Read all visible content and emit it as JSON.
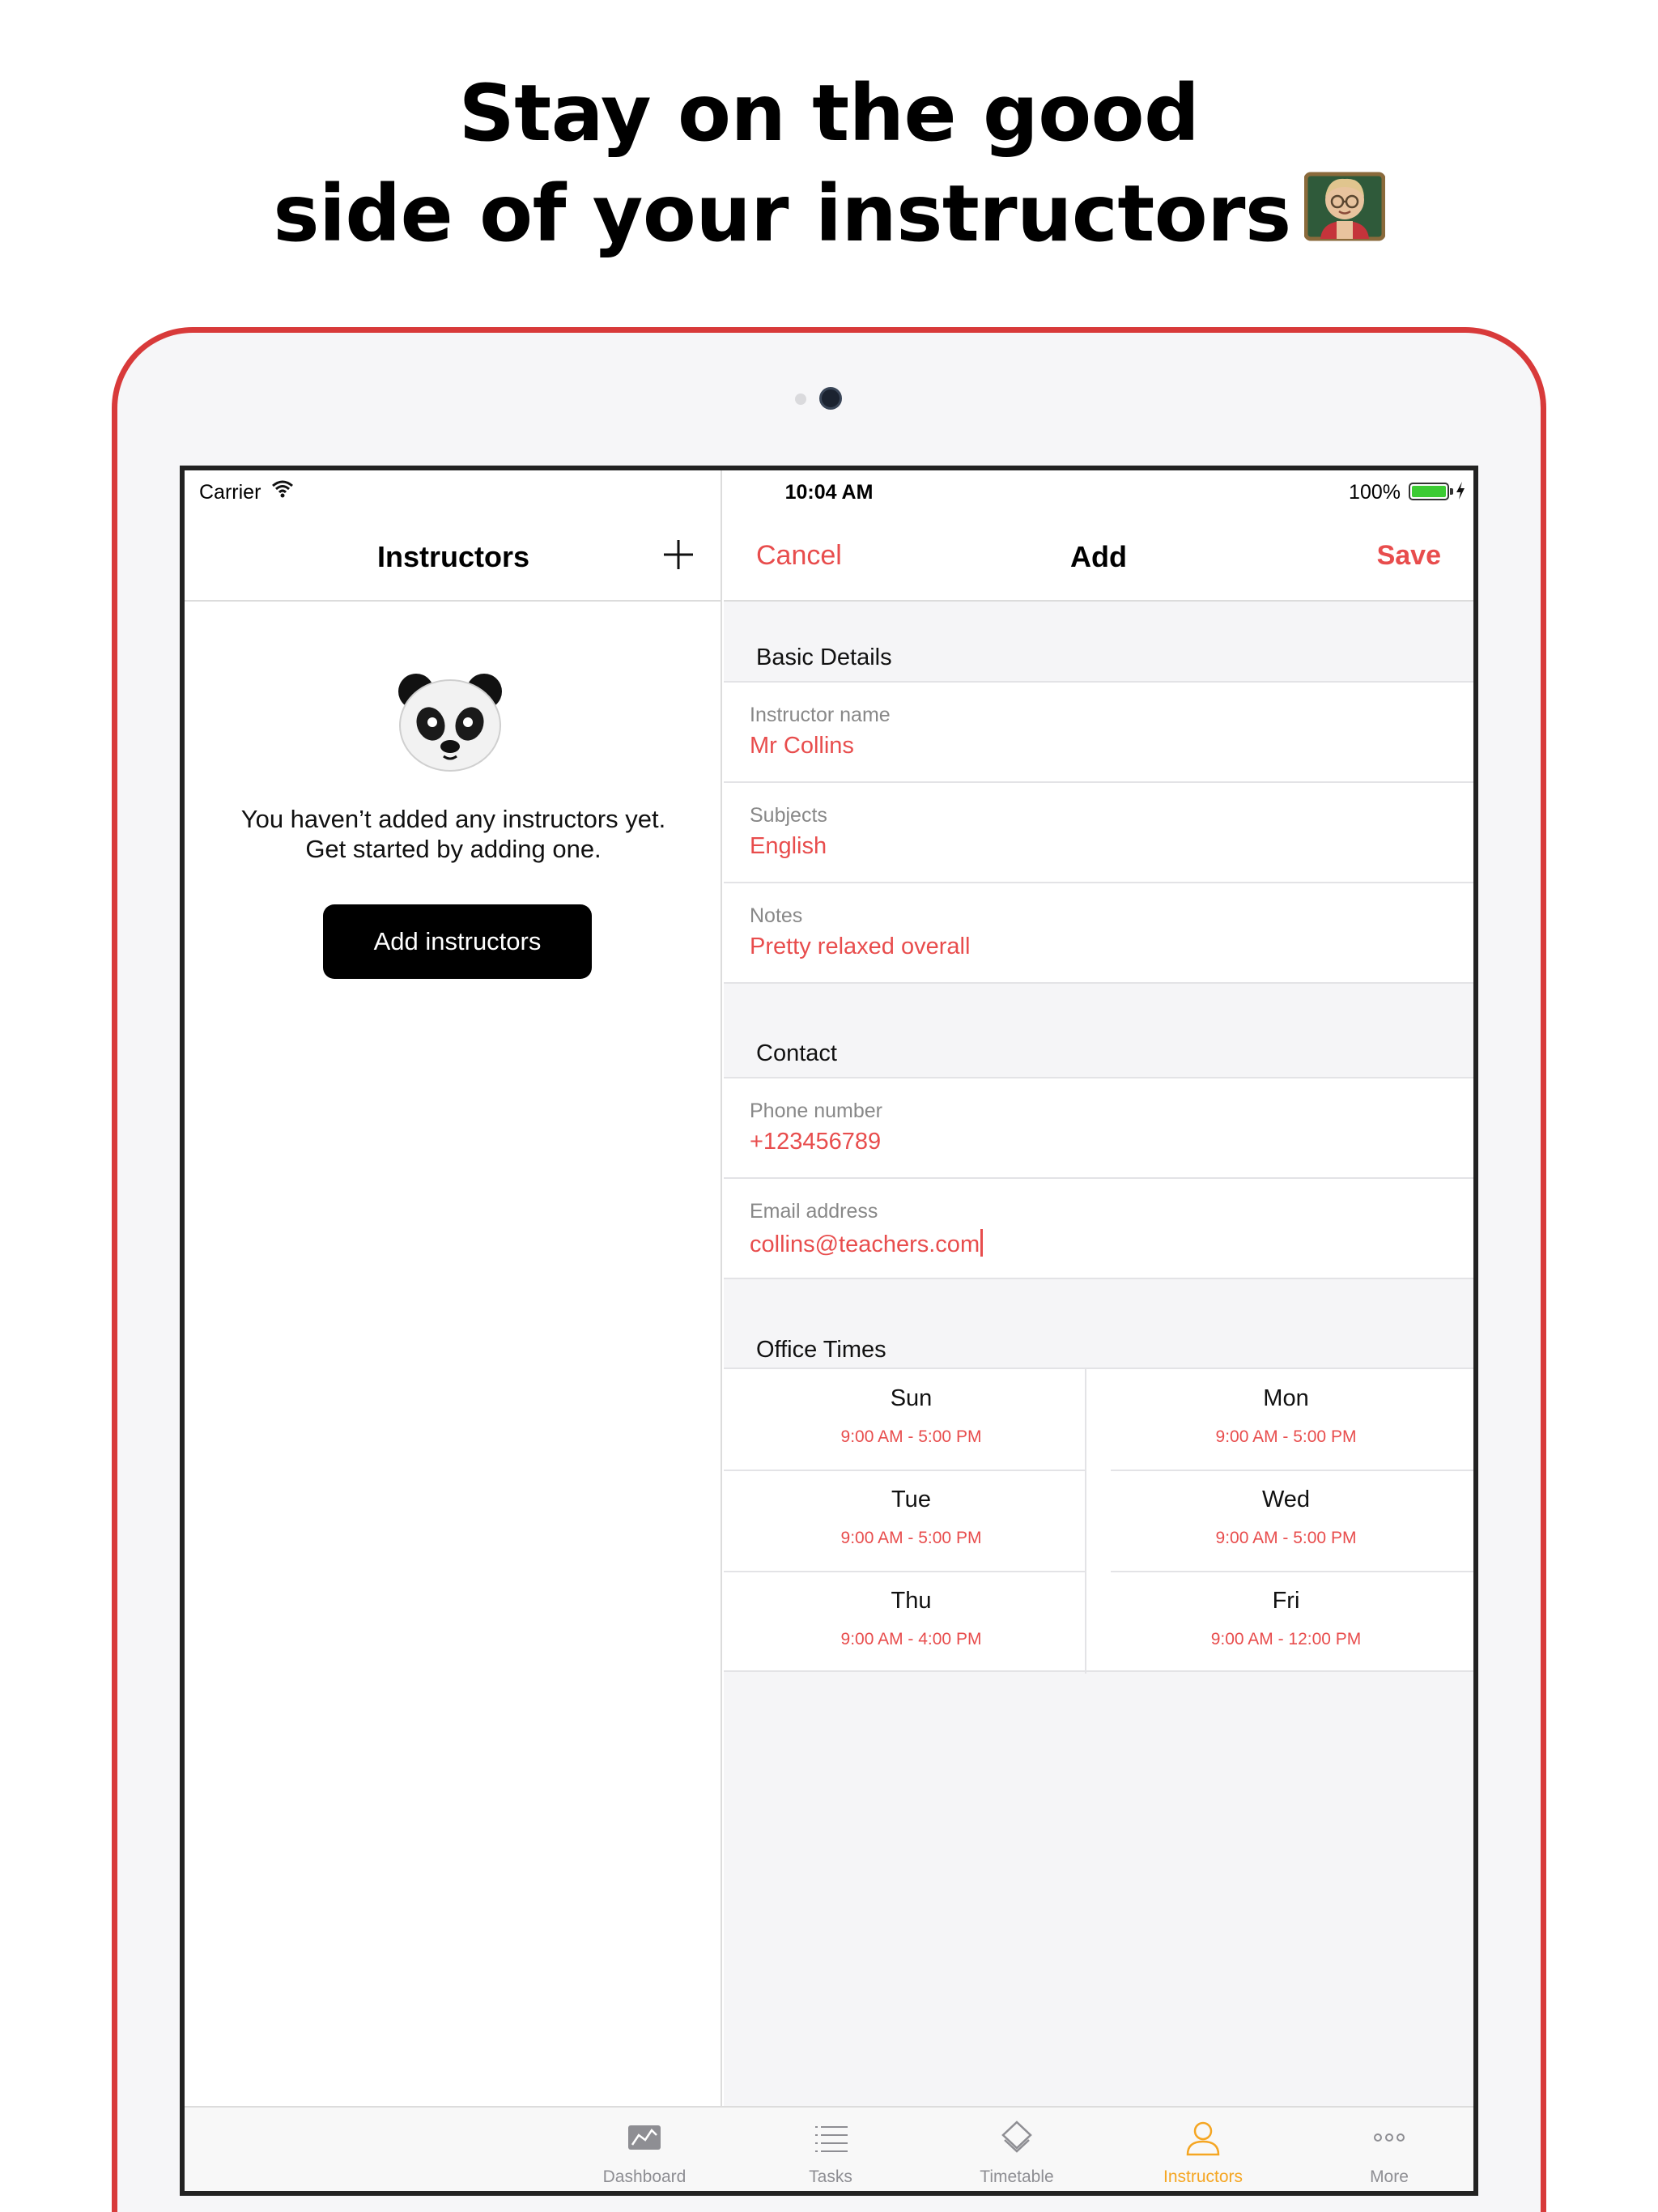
{
  "headline": {
    "line1": "Stay on the good",
    "line2": "side of your instructors"
  },
  "status_bar": {
    "carrier": "Carrier",
    "time": "10:04 AM",
    "battery": "100%"
  },
  "master": {
    "title": "Instructors",
    "empty_line1": "You haven’t added any instructors yet.",
    "empty_line2": "Get started by adding one.",
    "add_button": "Add instructors"
  },
  "detail": {
    "cancel": "Cancel",
    "title": "Add",
    "save": "Save",
    "basic_details": {
      "header": "Basic Details",
      "instructor_name_label": "Instructor name",
      "instructor_name_value": "Mr Collins",
      "subjects_label": "Subjects",
      "subjects_value": "English",
      "notes_label": "Notes",
      "notes_value": "Pretty relaxed overall"
    },
    "contact": {
      "header": "Contact",
      "phone_label": "Phone number",
      "phone_value": "+123456789",
      "email_label": "Email address",
      "email_value": "collins@teachers.com"
    },
    "office_times": {
      "header": "Office Times",
      "days": [
        {
          "day": "Sun",
          "hours": "9:00 AM - 5:00 PM"
        },
        {
          "day": "Mon",
          "hours": "9:00 AM - 5:00 PM"
        },
        {
          "day": "Tue",
          "hours": "9:00 AM - 5:00 PM"
        },
        {
          "day": "Wed",
          "hours": "9:00 AM - 5:00 PM"
        },
        {
          "day": "Thu",
          "hours": "9:00 AM - 4:00 PM"
        },
        {
          "day": "Fri",
          "hours": "9:00 AM - 12:00 PM"
        }
      ]
    }
  },
  "tab_bar": {
    "items": [
      {
        "label": "Dashboard",
        "icon": "chart-icon"
      },
      {
        "label": "Tasks",
        "icon": "list-icon"
      },
      {
        "label": "Timetable",
        "icon": "layers-icon"
      },
      {
        "label": "Instructors",
        "icon": "person-icon"
      },
      {
        "label": "More",
        "icon": "more-icon"
      }
    ],
    "active": "Instructors"
  },
  "colors": {
    "accent": "#e84d4d",
    "device": "#d83a3a",
    "tab_active": "#f5a623",
    "battery": "#3ccb33"
  }
}
